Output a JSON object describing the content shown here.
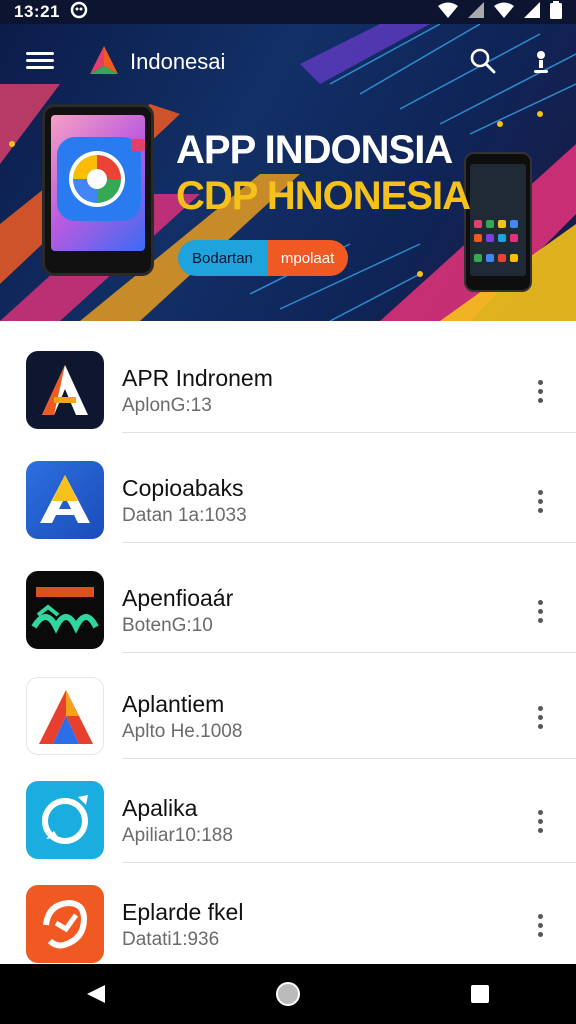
{
  "status_bar": {
    "time": "13:21",
    "icons": [
      "notification-icon",
      "wifi-icon",
      "signal-icon",
      "battery-icon"
    ]
  },
  "header": {
    "app_title": "Indonesai",
    "icons": [
      "menu-icon",
      "app-logo",
      "search-icon",
      "account-icon"
    ]
  },
  "banner": {
    "title_line1": "APP INDONSIA",
    "title_line2": "CDP HNONESIA",
    "button_primary": "Bodartan",
    "button_secondary": "mpolaat",
    "colors": {
      "accent_yellow": "#f6c21a",
      "accent_blue": "#1fa3dc",
      "accent_orange": "#f05a22"
    }
  },
  "app_list": [
    {
      "name": "APR Indronem",
      "subtitle": "AplonG:13",
      "icon": "app-a-dark-icon"
    },
    {
      "name": "Copioabaks",
      "subtitle": "Datan 1a:1033",
      "icon": "app-a-blue-icon"
    },
    {
      "name": "Apenfioaár",
      "subtitle": "BotenG:10",
      "icon": "app-padata-icon"
    },
    {
      "name": "Aplantiem",
      "subtitle": "Aplto He.1008",
      "icon": "app-a-white-icon"
    },
    {
      "name": "Apalika",
      "subtitle": "Apiliar10:188",
      "icon": "app-chat-icon"
    },
    {
      "name": "Eplarde fkel",
      "subtitle": "Datati1:936",
      "icon": "app-orange-icon"
    }
  ],
  "nav_bar": [
    "back-icon",
    "home-icon",
    "recents-icon"
  ]
}
